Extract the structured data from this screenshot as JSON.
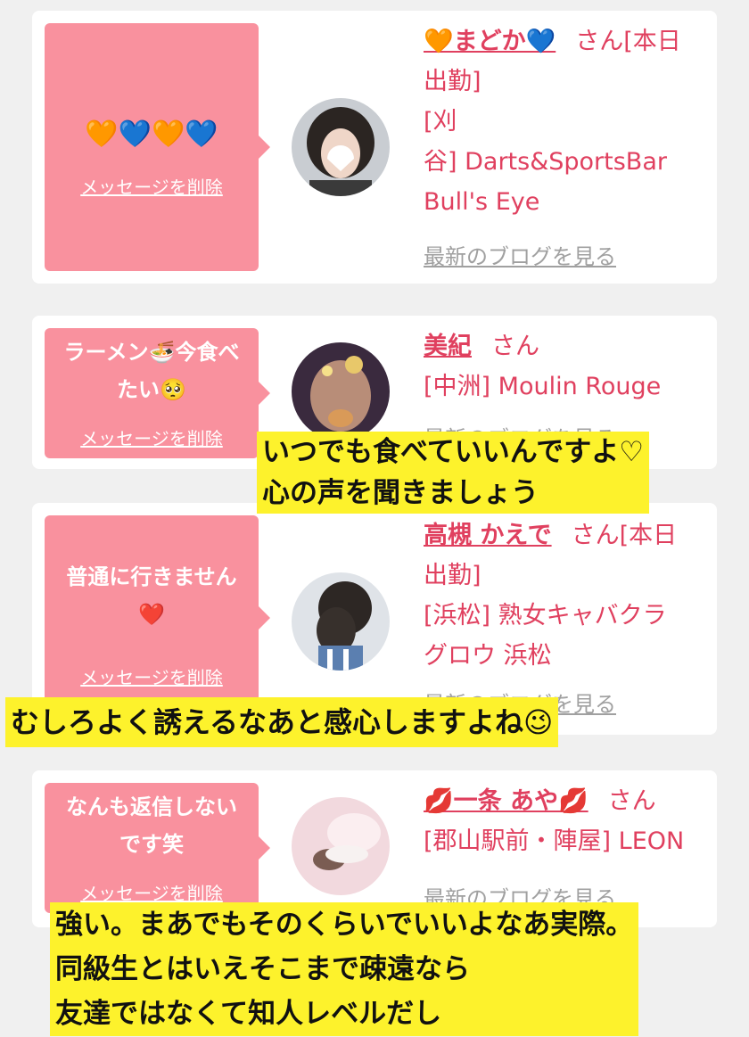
{
  "colors": {
    "bubble": "#f9919e",
    "accent": "#e0405f",
    "caption_bg": "#fdf22c"
  },
  "cards": [
    {
      "message": "🧡💙🧡💙",
      "delete_label": "メッセージを削除",
      "name": "🧡まどか💙",
      "san": "さん[本日",
      "status_line2": "出勤]",
      "area": "[刈",
      "area_line2": "谷] Darts&SportsBar",
      "shop_line2": "Bull's Eye",
      "blog_label": "最新のブログを見る"
    },
    {
      "message_line1": "ラーメン🍜今食べ",
      "message_line2": "たい🥺",
      "delete_label": "メッセージを削除",
      "name": "美紀",
      "san": "さん",
      "area": "[中洲] Moulin Rouge",
      "blog_label": "最新のブログを見る"
    },
    {
      "message_line1": "普通に行きません",
      "message_line2": "❤️",
      "delete_label": "メッセージを削除",
      "name": "高槻 かえで",
      "san": "さん[本日",
      "status_line2": "出勤]",
      "area": "[浜松] 熟女キャバクラ",
      "area_line2": "グロウ 浜松",
      "blog_label": "最新のブログを見る"
    },
    {
      "message_line1": "なんも返信しない",
      "message_line2": "です笑",
      "delete_label": "メッセージを削除",
      "name": "💋一条 あや💋",
      "san": "さん",
      "area": "[郡山駅前・陣屋] LEON",
      "blog_label": "最新のブログを見る"
    }
  ],
  "captions": [
    {
      "line1": "いつでも食べていいんですよ♡",
      "line2": "心の声を聞きましょう"
    },
    {
      "line1": "むしろよく誘えるなあと感心しますよね😉"
    },
    {
      "line1": "強い。まあでもそのくらいでいいよなあ実際。",
      "line2": "同級生とはいえそこまで疎遠なら",
      "line3": "友達ではなくて知人レベルだし"
    }
  ]
}
